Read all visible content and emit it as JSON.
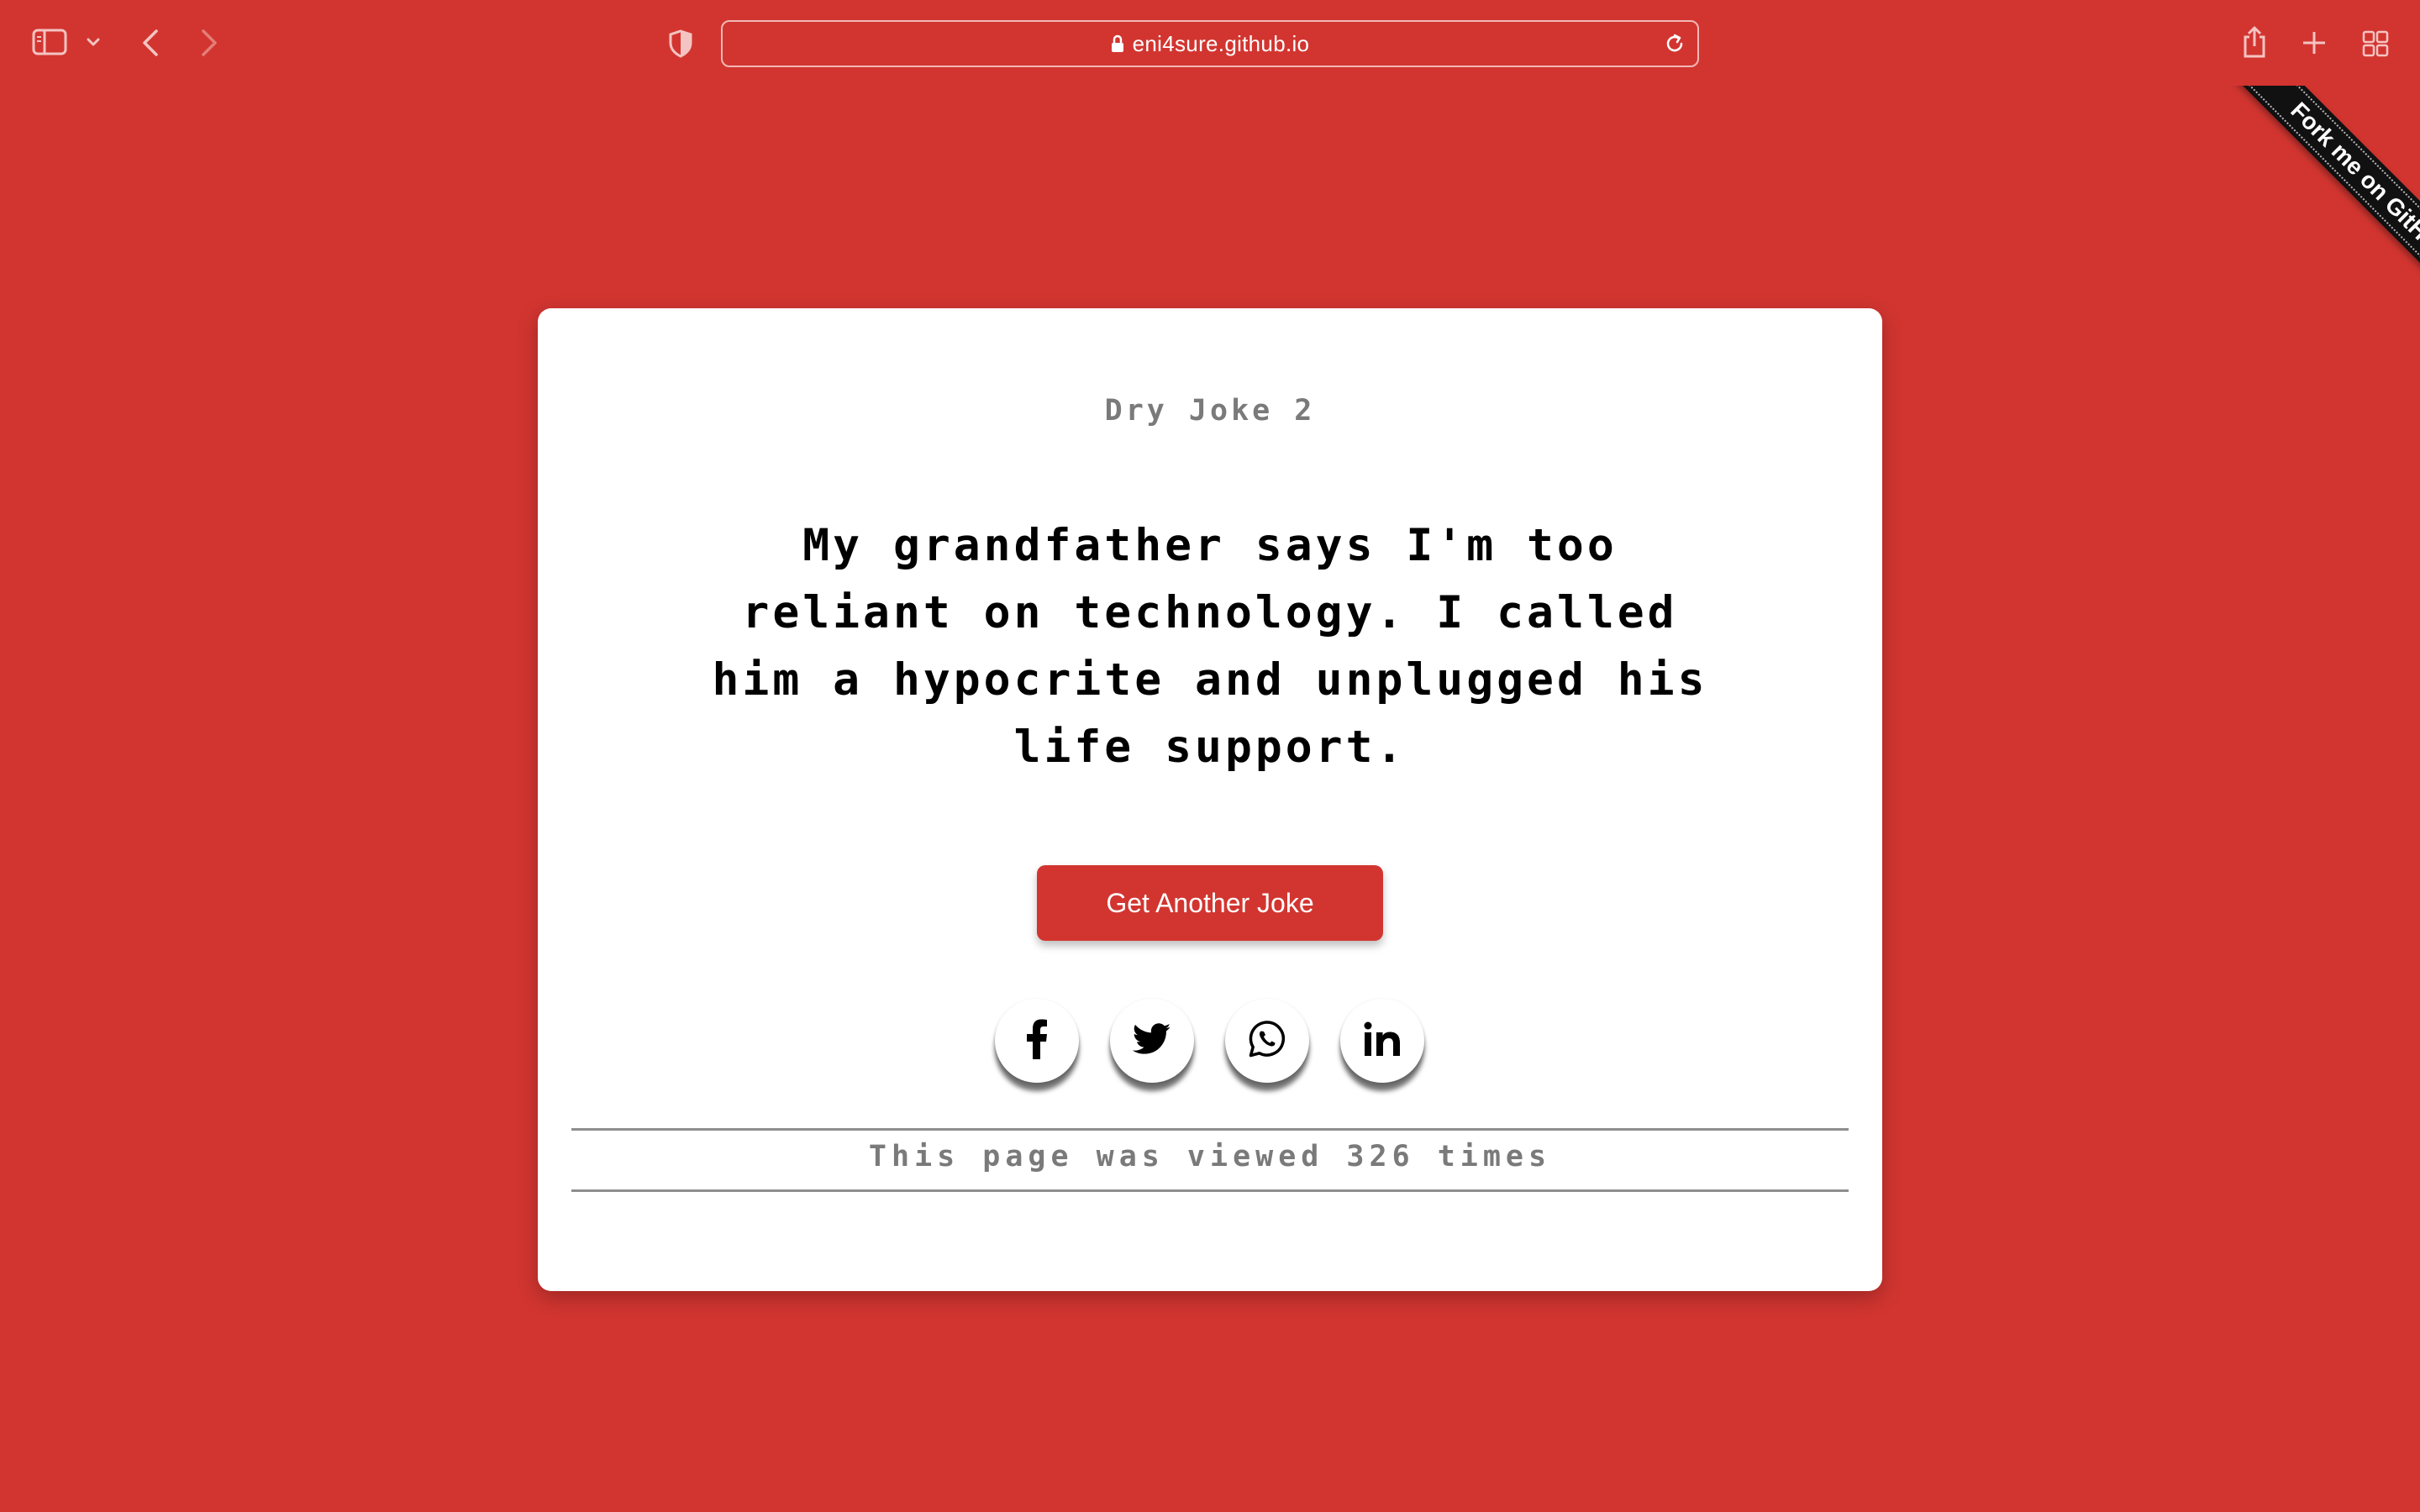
{
  "browser": {
    "url": "eni4sure.github.io",
    "icons": [
      "sidebar-icon",
      "chevron-down-icon",
      "back-arrow-icon",
      "forward-arrow-icon",
      "privacy-shield-icon",
      "lock-icon",
      "reload-icon",
      "share-icon",
      "new-tab-icon",
      "tab-overview-icon"
    ]
  },
  "ribbon": {
    "label": "Fork me on GitHub"
  },
  "card": {
    "title": "Dry Joke 2",
    "joke": "My grandfather says I'm too reliant on technology. I called him a hypocrite and unplugged his life support.",
    "button_label": "Get Another Joke",
    "social": [
      "facebook-icon",
      "twitter-icon",
      "whatsapp-icon",
      "linkedin-icon"
    ],
    "views_text": "This page was viewed 326 times"
  },
  "colors": {
    "accent": "#d23530",
    "card_bg": "#ffffff",
    "muted_text": "#7a7a7a"
  }
}
